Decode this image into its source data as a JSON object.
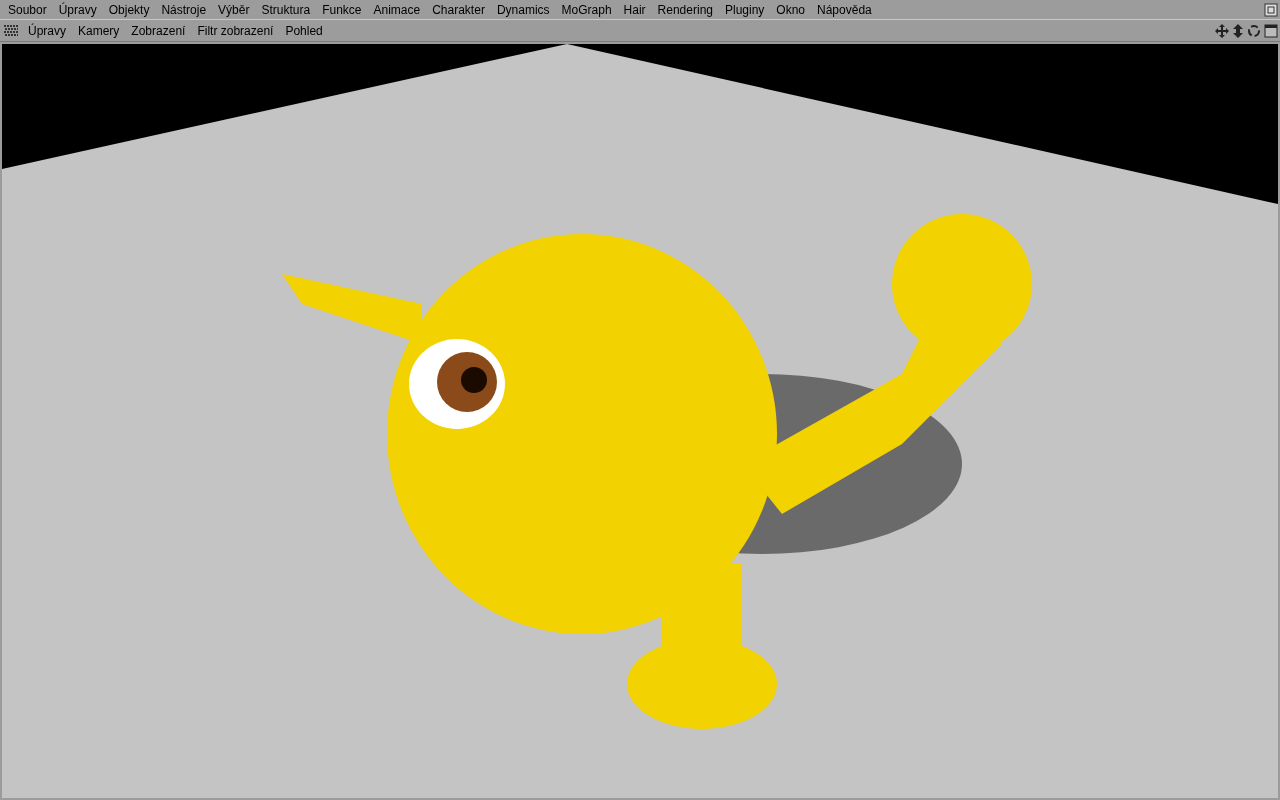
{
  "menu_bar": {
    "items": [
      "Soubor",
      "Úpravy",
      "Objekty",
      "Nástroje",
      "Výběr",
      "Struktura",
      "Funkce",
      "Animace",
      "Charakter",
      "Dynamics",
      "MoGraph",
      "Hair",
      "Rendering",
      "Pluginy",
      "Okno",
      "Nápověda"
    ]
  },
  "viewport": {
    "menu": [
      "Úpravy",
      "Kamery",
      "Zobrazení",
      "Filtr zobrazení",
      "Pohled"
    ]
  }
}
